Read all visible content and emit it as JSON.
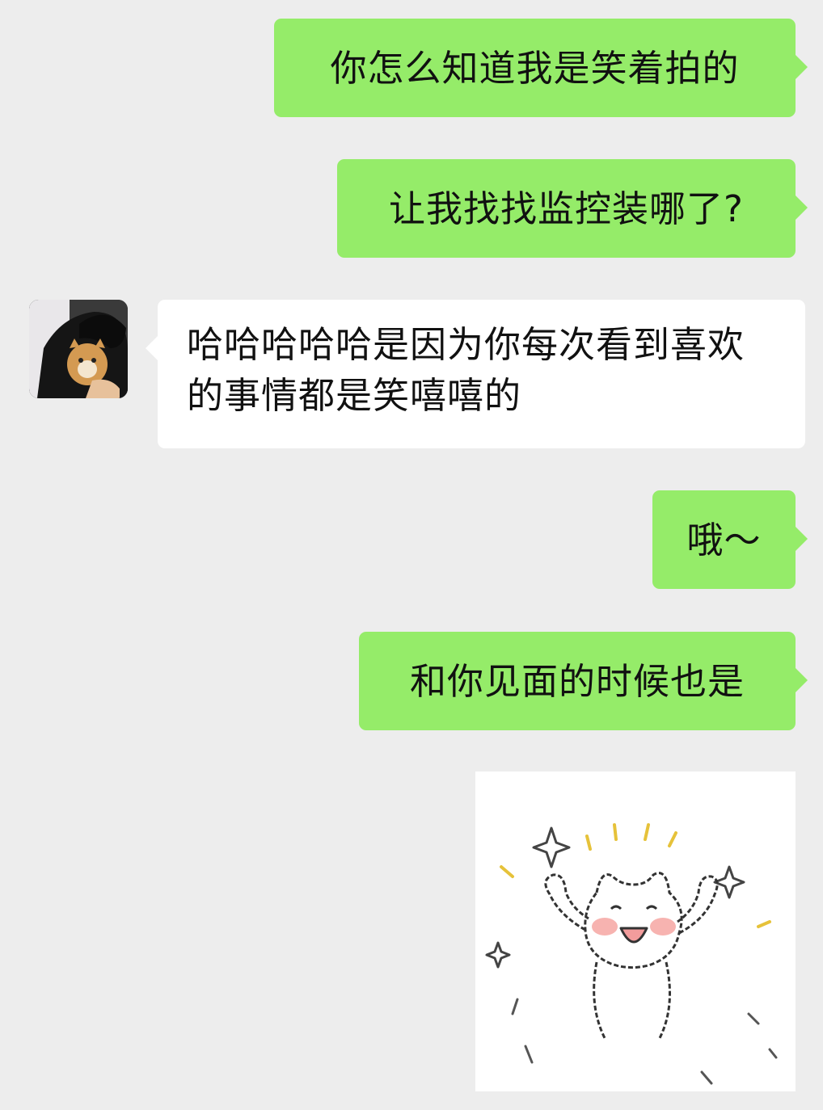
{
  "messages": [
    {
      "direction": "outgoing",
      "text": "你怎么知道我是笑着拍的"
    },
    {
      "direction": "outgoing",
      "text": "让我找找监控装哪了?"
    },
    {
      "direction": "incoming",
      "text": "哈哈哈哈哈是因为你每次看到喜欢的事情都是笑嘻嘻的"
    },
    {
      "direction": "outgoing",
      "text": "哦～"
    },
    {
      "direction": "outgoing",
      "text": "和你见面的时候也是"
    },
    {
      "direction": "outgoing",
      "type": "sticker",
      "sticker": "happy-cat-sticker"
    }
  ],
  "colors": {
    "background": "#ededed",
    "outgoing_bubble": "#95ec69",
    "incoming_bubble": "#ffffff",
    "sparkle": "#e6c23a",
    "blush": "#f7b3b0"
  },
  "avatar": {
    "icon": "avatar-person-with-cat"
  }
}
